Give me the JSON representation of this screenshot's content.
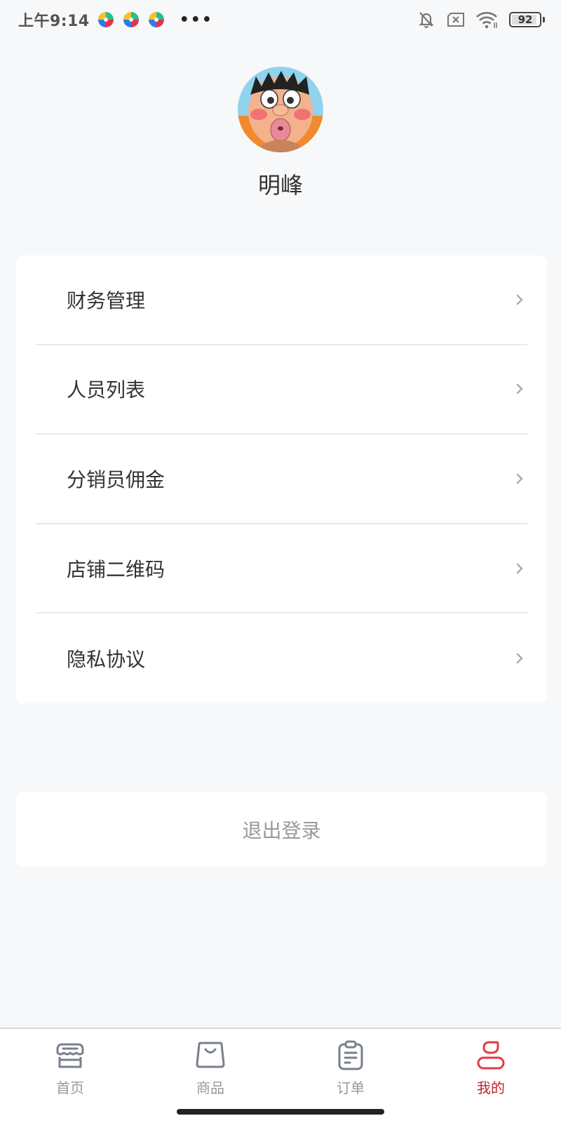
{
  "status_bar": {
    "time": "上午9:14",
    "app_icons": [
      "colorful-app-icon",
      "colorful-app-icon",
      "colorful-app-icon"
    ],
    "more": "•••",
    "icons": [
      "bell-muted-icon",
      "sim-none-icon",
      "wifi-icon",
      "battery-icon"
    ],
    "battery_level": "92",
    "battery_fraction": 0.92
  },
  "profile": {
    "avatar": "cartoon-avatar",
    "name": "明峰"
  },
  "menu": {
    "items": [
      {
        "label": "财务管理"
      },
      {
        "label": "人员列表"
      },
      {
        "label": "分销员佣金"
      },
      {
        "label": "店铺二维码"
      },
      {
        "label": "隐私协议"
      }
    ]
  },
  "logout": {
    "label": "退出登录"
  },
  "tab_bar": {
    "active_color": "#c4202a",
    "inactive_color": "#999999",
    "tabs": [
      {
        "label": "首页",
        "icon": "store-icon",
        "active": false
      },
      {
        "label": "商品",
        "icon": "shopping-bag-icon",
        "active": false
      },
      {
        "label": "订单",
        "icon": "clipboard-icon",
        "active": false
      },
      {
        "label": "我的",
        "icon": "user-icon",
        "active": true
      }
    ]
  }
}
